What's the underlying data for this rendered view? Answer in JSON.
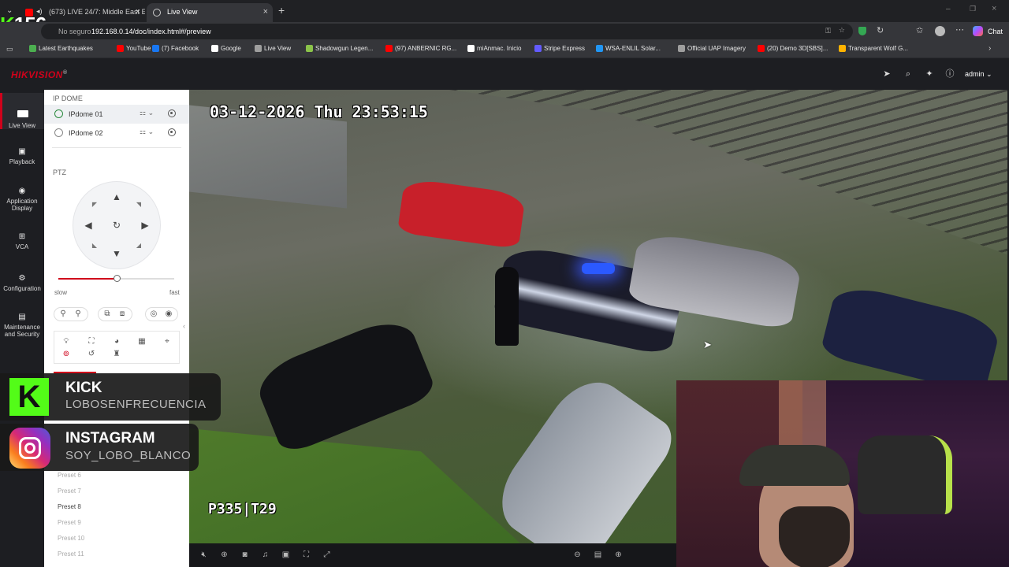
{
  "browser": {
    "tabs": [
      {
        "title": "(673) LIVE 24/7: Middle East E",
        "active": false
      },
      {
        "title": "Live View",
        "active": true
      }
    ],
    "url_prefix": "No seguro",
    "url": "192.168.0.14/doc/index.html#/preview",
    "chat_label": "Chat",
    "bookmarks": [
      {
        "label": "Latest Earthquakes",
        "color": "#4caf50"
      },
      {
        "label": "YouTube",
        "color": "#ff0000"
      },
      {
        "label": "(7) Facebook",
        "color": "#1877f2"
      },
      {
        "label": "Google",
        "color": "#ffffff"
      },
      {
        "label": "Live View",
        "color": "#9e9e9e"
      },
      {
        "label": "Shadowgun Legen...",
        "color": "#8bc34a"
      },
      {
        "label": "(97) ANBERNIC RG...",
        "color": "#ff0000"
      },
      {
        "label": "miAnmac. Inicio",
        "color": "#ffffff"
      },
      {
        "label": "Stripe Express",
        "color": "#635bff"
      },
      {
        "label": "WSA-ENLIL Solar...",
        "color": "#2196f3"
      },
      {
        "label": "Official UAP Imagery",
        "color": "#9e9e9e"
      },
      {
        "label": "(20) Demo 3D[SBS]...",
        "color": "#ff0000"
      },
      {
        "label": "Transparent Wolf G...",
        "color": "#ffb300"
      }
    ]
  },
  "overlay_counter": {
    "k": "K",
    "value": "156"
  },
  "app": {
    "brand": "HIKVISION",
    "brand_mark": "®",
    "user": "admin",
    "accent": "#d0021b"
  },
  "nav": [
    {
      "label": "Live View",
      "icon": "monitor-icon",
      "active": true
    },
    {
      "label": "Playback",
      "icon": "playback-icon",
      "active": false
    },
    {
      "label": "Application Display",
      "icon": "app-display-icon",
      "active": false
    },
    {
      "label": "VCA",
      "icon": "vca-icon",
      "active": false
    },
    {
      "label": "Configuration",
      "icon": "gear-icon",
      "active": false
    },
    {
      "label": "Maintenance and Security",
      "icon": "maintenance-icon",
      "active": false
    }
  ],
  "panel": {
    "section_devices": "IP DOME",
    "cameras": [
      {
        "name": "IPdome 01",
        "selected": true
      },
      {
        "name": "IPdome 02",
        "selected": false
      }
    ],
    "section_ptz": "PTZ",
    "speed_slow": "slow",
    "speed_fast": "fast",
    "speed_level": 0.5,
    "presets": [
      "Preset 6",
      "Preset 7",
      "Preset 8",
      "Preset 9",
      "Preset 10",
      "Preset 11"
    ],
    "preset_highlight": "Preset 8"
  },
  "video": {
    "osd_time": "03-12-2026 Thu 23:53:15",
    "osd_ptz": "P335|T29"
  },
  "socials": [
    {
      "platform": "KICK",
      "handle": "LOBOSENFRECUENCIA",
      "color": "#53fc18"
    },
    {
      "platform": "INSTAGRAM",
      "handle": "SOY_LOBO_BLANCO",
      "color": "#d62976"
    }
  ]
}
